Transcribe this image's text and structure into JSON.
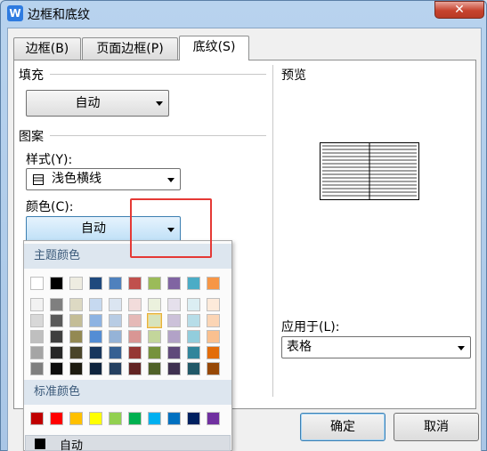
{
  "window": {
    "title": "边框和底纹",
    "close_glyph": "✕",
    "app_icon_glyph": "W"
  },
  "tabs": [
    {
      "label": "边框(B)"
    },
    {
      "label": "页面边框(P)"
    },
    {
      "label": "底纹(S)"
    }
  ],
  "fill": {
    "label": "填充",
    "value": "自动"
  },
  "pattern": {
    "label": "图案",
    "style_label": "样式(Y):",
    "style_value": "浅色横线",
    "color_label": "颜色(C):",
    "color_value": "自动"
  },
  "preview": {
    "label": "预览"
  },
  "apply_to": {
    "label": "应用于(L):",
    "value": "表格"
  },
  "palette": {
    "theme_label": "主题颜色",
    "standard_label": "标准颜色",
    "auto_label": "自动",
    "theme_top": [
      "#ffffff",
      "#000000",
      "#eeece1",
      "#1f497d",
      "#4f81bd",
      "#c0504d",
      "#9bbb59",
      "#8064a2",
      "#4bacc6",
      "#f79646"
    ],
    "theme_shades": [
      [
        "#f2f2f2",
        "#7f7f7f",
        "#ddd9c3",
        "#c6d9f0",
        "#dbe5f1",
        "#f2dcdb",
        "#ebf1dd",
        "#e5e0ec",
        "#dbeef3",
        "#fdeada"
      ],
      [
        "#d8d8d8",
        "#595959",
        "#c4bd97",
        "#8db3e2",
        "#b8cce4",
        "#e5b9b7",
        "#d7e3bc",
        "#ccc1d9",
        "#b7dde8",
        "#fbd5b5"
      ],
      [
        "#bfbfbf",
        "#3f3f3f",
        "#938953",
        "#548dd4",
        "#95b3d7",
        "#d99694",
        "#c3d69b",
        "#b2a2c7",
        "#92cddc",
        "#fac08f"
      ],
      [
        "#a5a5a5",
        "#262626",
        "#494429",
        "#17365d",
        "#366092",
        "#953734",
        "#76923c",
        "#5f497a",
        "#31859b",
        "#e36c09"
      ],
      [
        "#7f7f7f",
        "#0c0c0c",
        "#1d1b10",
        "#0f243e",
        "#244061",
        "#632423",
        "#4f6128",
        "#3f3151",
        "#205867",
        "#974806"
      ]
    ],
    "standard": [
      "#c00000",
      "#ff0000",
      "#ffc000",
      "#ffff00",
      "#92d050",
      "#00b050",
      "#00b0f0",
      "#0070c0",
      "#002060",
      "#7030a0"
    ]
  },
  "buttons": {
    "ok": "确定",
    "cancel": "取消"
  }
}
